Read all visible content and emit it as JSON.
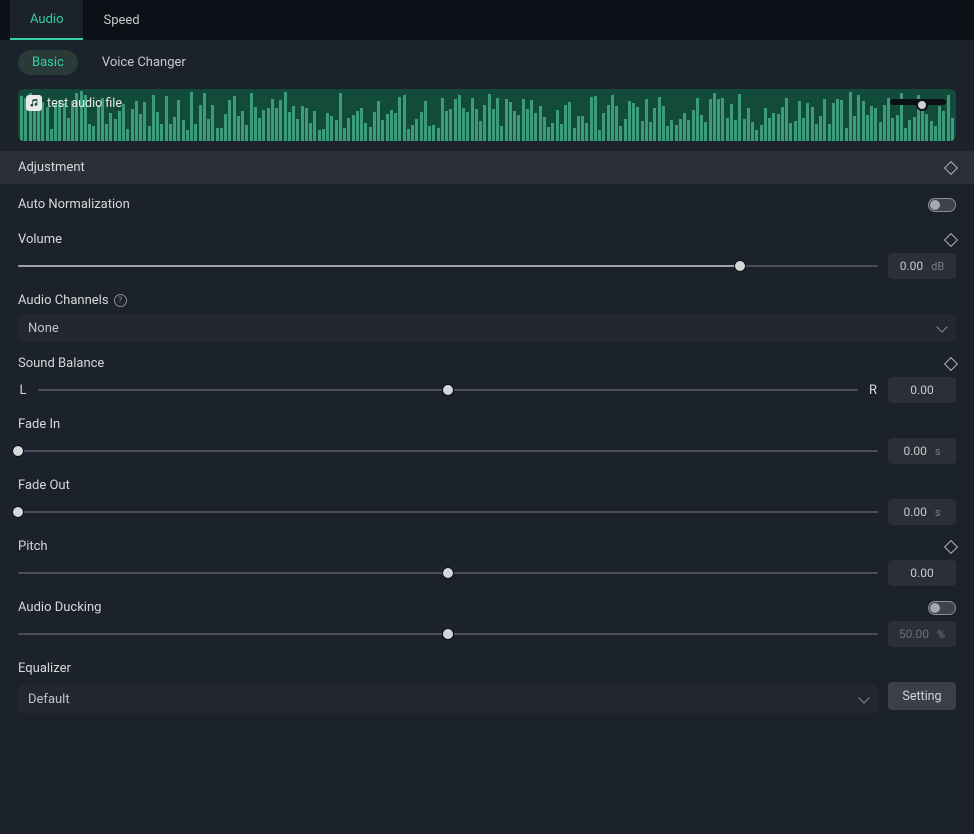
{
  "tabs": {
    "audio": "Audio",
    "speed": "Speed"
  },
  "subtabs": {
    "basic": "Basic",
    "voice": "Voice Changer"
  },
  "waveform": {
    "title": "test audio file"
  },
  "section": {
    "adjustment": "Adjustment"
  },
  "autoNorm": {
    "label": "Auto Normalization",
    "enabled": false
  },
  "volume": {
    "label": "Volume",
    "value": "0.00",
    "unit": "dB",
    "percent": 84
  },
  "audioChannels": {
    "label": "Audio Channels",
    "selected": "None"
  },
  "soundBalance": {
    "label": "Sound Balance",
    "left": "L",
    "right": "R",
    "value": "0.00",
    "percent": 50
  },
  "fadeIn": {
    "label": "Fade In",
    "value": "0.00",
    "unit": "s",
    "percent": 0
  },
  "fadeOut": {
    "label": "Fade Out",
    "value": "0.00",
    "unit": "s",
    "percent": 0
  },
  "pitch": {
    "label": "Pitch",
    "value": "0.00",
    "percent": 50
  },
  "audioDucking": {
    "label": "Audio Ducking",
    "enabled": false,
    "value": "50.00",
    "unit": "%",
    "percent": 50
  },
  "equalizer": {
    "label": "Equalizer",
    "selected": "Default",
    "settingBtn": "Setting"
  }
}
